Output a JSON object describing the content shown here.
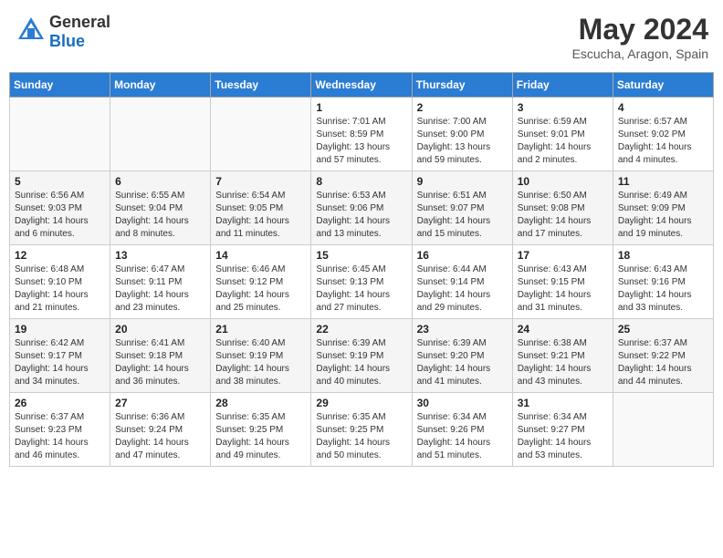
{
  "header": {
    "logo_general": "General",
    "logo_blue": "Blue",
    "month_title": "May 2024",
    "location": "Escucha, Aragon, Spain"
  },
  "weekdays": [
    "Sunday",
    "Monday",
    "Tuesday",
    "Wednesday",
    "Thursday",
    "Friday",
    "Saturday"
  ],
  "weeks": [
    [
      {
        "day": "",
        "empty": true
      },
      {
        "day": "",
        "empty": true
      },
      {
        "day": "",
        "empty": true
      },
      {
        "day": "1",
        "sunrise": "Sunrise: 7:01 AM",
        "sunset": "Sunset: 8:59 PM",
        "daylight": "Daylight: 13 hours and 57 minutes."
      },
      {
        "day": "2",
        "sunrise": "Sunrise: 7:00 AM",
        "sunset": "Sunset: 9:00 PM",
        "daylight": "Daylight: 13 hours and 59 minutes."
      },
      {
        "day": "3",
        "sunrise": "Sunrise: 6:59 AM",
        "sunset": "Sunset: 9:01 PM",
        "daylight": "Daylight: 14 hours and 2 minutes."
      },
      {
        "day": "4",
        "sunrise": "Sunrise: 6:57 AM",
        "sunset": "Sunset: 9:02 PM",
        "daylight": "Daylight: 14 hours and 4 minutes."
      }
    ],
    [
      {
        "day": "5",
        "sunrise": "Sunrise: 6:56 AM",
        "sunset": "Sunset: 9:03 PM",
        "daylight": "Daylight: 14 hours and 6 minutes."
      },
      {
        "day": "6",
        "sunrise": "Sunrise: 6:55 AM",
        "sunset": "Sunset: 9:04 PM",
        "daylight": "Daylight: 14 hours and 8 minutes."
      },
      {
        "day": "7",
        "sunrise": "Sunrise: 6:54 AM",
        "sunset": "Sunset: 9:05 PM",
        "daylight": "Daylight: 14 hours and 11 minutes."
      },
      {
        "day": "8",
        "sunrise": "Sunrise: 6:53 AM",
        "sunset": "Sunset: 9:06 PM",
        "daylight": "Daylight: 14 hours and 13 minutes."
      },
      {
        "day": "9",
        "sunrise": "Sunrise: 6:51 AM",
        "sunset": "Sunset: 9:07 PM",
        "daylight": "Daylight: 14 hours and 15 minutes."
      },
      {
        "day": "10",
        "sunrise": "Sunrise: 6:50 AM",
        "sunset": "Sunset: 9:08 PM",
        "daylight": "Daylight: 14 hours and 17 minutes."
      },
      {
        "day": "11",
        "sunrise": "Sunrise: 6:49 AM",
        "sunset": "Sunset: 9:09 PM",
        "daylight": "Daylight: 14 hours and 19 minutes."
      }
    ],
    [
      {
        "day": "12",
        "sunrise": "Sunrise: 6:48 AM",
        "sunset": "Sunset: 9:10 PM",
        "daylight": "Daylight: 14 hours and 21 minutes."
      },
      {
        "day": "13",
        "sunrise": "Sunrise: 6:47 AM",
        "sunset": "Sunset: 9:11 PM",
        "daylight": "Daylight: 14 hours and 23 minutes."
      },
      {
        "day": "14",
        "sunrise": "Sunrise: 6:46 AM",
        "sunset": "Sunset: 9:12 PM",
        "daylight": "Daylight: 14 hours and 25 minutes."
      },
      {
        "day": "15",
        "sunrise": "Sunrise: 6:45 AM",
        "sunset": "Sunset: 9:13 PM",
        "daylight": "Daylight: 14 hours and 27 minutes."
      },
      {
        "day": "16",
        "sunrise": "Sunrise: 6:44 AM",
        "sunset": "Sunset: 9:14 PM",
        "daylight": "Daylight: 14 hours and 29 minutes."
      },
      {
        "day": "17",
        "sunrise": "Sunrise: 6:43 AM",
        "sunset": "Sunset: 9:15 PM",
        "daylight": "Daylight: 14 hours and 31 minutes."
      },
      {
        "day": "18",
        "sunrise": "Sunrise: 6:43 AM",
        "sunset": "Sunset: 9:16 PM",
        "daylight": "Daylight: 14 hours and 33 minutes."
      }
    ],
    [
      {
        "day": "19",
        "sunrise": "Sunrise: 6:42 AM",
        "sunset": "Sunset: 9:17 PM",
        "daylight": "Daylight: 14 hours and 34 minutes."
      },
      {
        "day": "20",
        "sunrise": "Sunrise: 6:41 AM",
        "sunset": "Sunset: 9:18 PM",
        "daylight": "Daylight: 14 hours and 36 minutes."
      },
      {
        "day": "21",
        "sunrise": "Sunrise: 6:40 AM",
        "sunset": "Sunset: 9:19 PM",
        "daylight": "Daylight: 14 hours and 38 minutes."
      },
      {
        "day": "22",
        "sunrise": "Sunrise: 6:39 AM",
        "sunset": "Sunset: 9:19 PM",
        "daylight": "Daylight: 14 hours and 40 minutes."
      },
      {
        "day": "23",
        "sunrise": "Sunrise: 6:39 AM",
        "sunset": "Sunset: 9:20 PM",
        "daylight": "Daylight: 14 hours and 41 minutes."
      },
      {
        "day": "24",
        "sunrise": "Sunrise: 6:38 AM",
        "sunset": "Sunset: 9:21 PM",
        "daylight": "Daylight: 14 hours and 43 minutes."
      },
      {
        "day": "25",
        "sunrise": "Sunrise: 6:37 AM",
        "sunset": "Sunset: 9:22 PM",
        "daylight": "Daylight: 14 hours and 44 minutes."
      }
    ],
    [
      {
        "day": "26",
        "sunrise": "Sunrise: 6:37 AM",
        "sunset": "Sunset: 9:23 PM",
        "daylight": "Daylight: 14 hours and 46 minutes."
      },
      {
        "day": "27",
        "sunrise": "Sunrise: 6:36 AM",
        "sunset": "Sunset: 9:24 PM",
        "daylight": "Daylight: 14 hours and 47 minutes."
      },
      {
        "day": "28",
        "sunrise": "Sunrise: 6:35 AM",
        "sunset": "Sunset: 9:25 PM",
        "daylight": "Daylight: 14 hours and 49 minutes."
      },
      {
        "day": "29",
        "sunrise": "Sunrise: 6:35 AM",
        "sunset": "Sunset: 9:25 PM",
        "daylight": "Daylight: 14 hours and 50 minutes."
      },
      {
        "day": "30",
        "sunrise": "Sunrise: 6:34 AM",
        "sunset": "Sunset: 9:26 PM",
        "daylight": "Daylight: 14 hours and 51 minutes."
      },
      {
        "day": "31",
        "sunrise": "Sunrise: 6:34 AM",
        "sunset": "Sunset: 9:27 PM",
        "daylight": "Daylight: 14 hours and 53 minutes."
      },
      {
        "day": "",
        "empty": true
      }
    ]
  ]
}
